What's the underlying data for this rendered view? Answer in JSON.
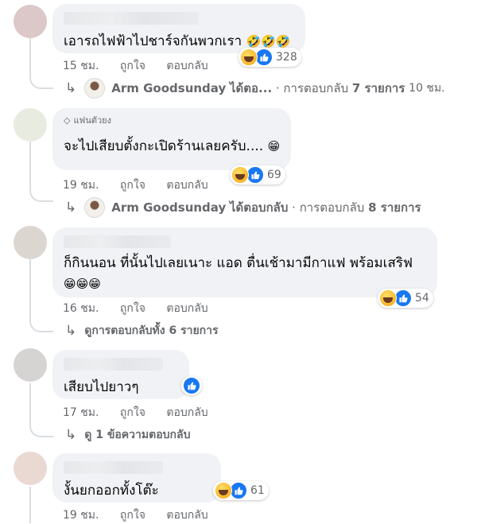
{
  "comments": [
    {
      "id": "c1",
      "avatar_color": "#dcc8c8",
      "badge": "",
      "text": "เอารถไฟฟ้าไปชาร์จกันพวกเรา",
      "emoji": "🤣🤣🤣",
      "time": "15 ชม.",
      "like_label": "ถูกใจ",
      "reply_label": "ตอบกลับ",
      "reactions": {
        "icons": [
          "haha-icon",
          "like-icon"
        ],
        "count": "328"
      },
      "reply_summary": {
        "author": "Arm Goodsunday",
        "action": "ได้ตอ...",
        "prefix": "· การตอบกลับ",
        "count_text": "7 รายการ",
        "time": "10 ชม."
      }
    },
    {
      "id": "c2",
      "avatar_color": "#e8ebe0",
      "badge": "แฟนตัวยง",
      "text": "จะไปเสียบตั้งกะเปิดร้านเลยครับ....",
      "emoji": "😁",
      "time": "19 ชม.",
      "like_label": "ถูกใจ",
      "reply_label": "ตอบกลับ",
      "reactions": {
        "icons": [
          "haha-icon",
          "like-icon"
        ],
        "count": "69"
      },
      "reply_summary": {
        "author": "Arm Goodsunday",
        "action": "ได้ตอบกลับ",
        "prefix": "· การตอบกลับ",
        "count_text": "8 รายการ",
        "time": ""
      }
    },
    {
      "id": "c3",
      "avatar_color": "#dcd6d1",
      "badge": "",
      "text": "ก็กินนอน ที่นั้นไปเลยเนาะ แอด ตื่นเช้ามามีกาแฟ พร้อมเสริฟ",
      "emoji": "😁😁😁",
      "time": "16 ชม.",
      "like_label": "ถูกใจ",
      "reply_label": "ตอบกลับ",
      "reactions": {
        "icons": [
          "haha-icon",
          "like-icon"
        ],
        "count": "54"
      },
      "reply_summary": {
        "text": "ดูการตอบกลับทั้ง 6 รายการ"
      }
    },
    {
      "id": "c4",
      "avatar_color": "#d6d4d2",
      "badge": "",
      "text": "เสียบไปยาวๆ",
      "emoji": "",
      "time": "17 ชม.",
      "like_label": "ถูกใจ",
      "reply_label": "ตอบกลับ",
      "reactions": {
        "icons": [
          "like-icon"
        ],
        "count": ""
      },
      "reply_summary": {
        "text": "ดู 1 ข้อความตอบกลับ"
      }
    },
    {
      "id": "c5",
      "avatar_color": "#ead8d2",
      "badge": "",
      "text": "งั้นยกออกทั้งโต๊ะ",
      "emoji": "",
      "time": "19 ชม.",
      "like_label": "ถูกใจ",
      "reply_label": "ตอบกลับ",
      "reactions": {
        "icons": [
          "haha-icon",
          "like-icon"
        ],
        "count": "61"
      }
    }
  ]
}
